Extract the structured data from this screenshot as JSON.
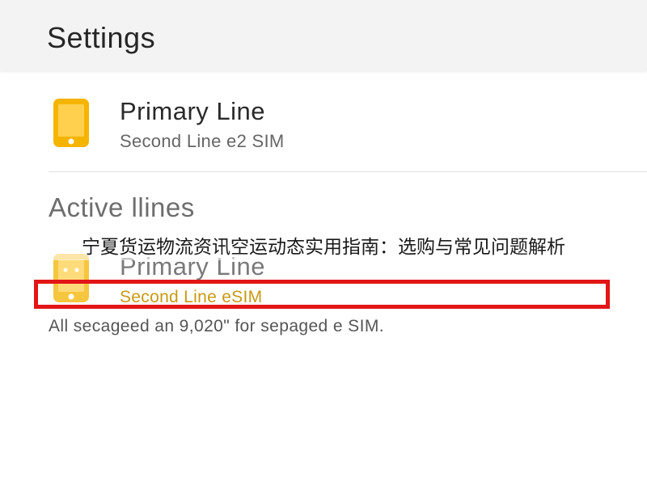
{
  "header": {
    "title": "Settings"
  },
  "primary_line": {
    "title": "Primary Line",
    "subtitle": "Second Line e2 SIM",
    "icon": "phone-icon"
  },
  "active_lines": {
    "section_title": "Active llines",
    "item": {
      "title": "Primary Line",
      "subtitle": "Second Line eSIM",
      "icon": "phone-icon"
    },
    "note": "All secageed an 9,020\" for sepaged e SIM."
  },
  "overlay": {
    "caption": "宁夏货运物流资讯空运动态实用指南：选购与常见问题解析"
  },
  "colors": {
    "accent": "#F5B400",
    "highlight": "#E21616",
    "subtitle_accent": "#C89A12"
  }
}
